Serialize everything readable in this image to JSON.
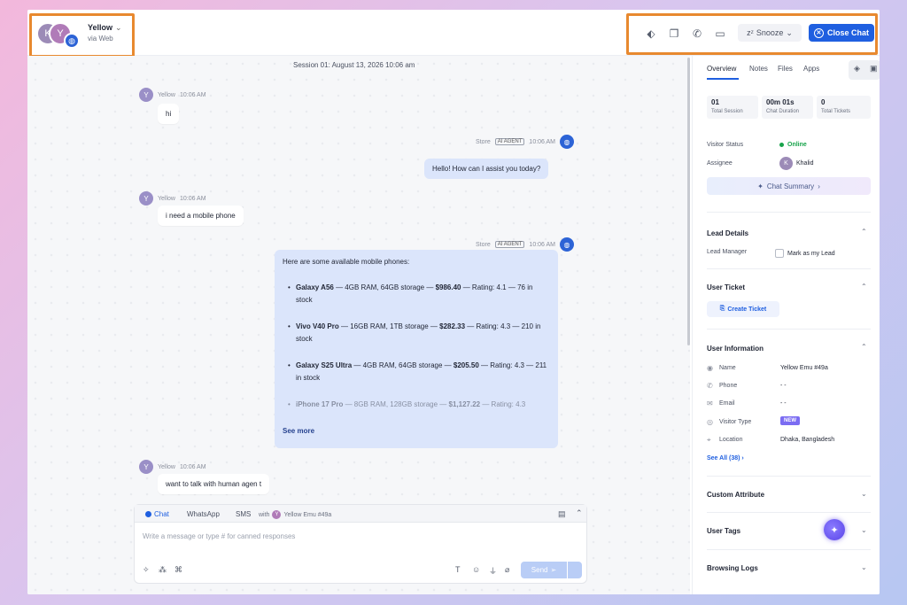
{
  "header": {
    "contact_name": "Yellow",
    "contact_sub": "via Web",
    "avatar_k": "K",
    "avatar_y": "Y",
    "snooze_label": "Snooze",
    "close_label": "Close Chat"
  },
  "chat": {
    "session_label": "Session 01: August 13, 2026 10:06 am",
    "messages": [
      {
        "sender": "Yellow",
        "time": "10:06 AM",
        "text": "hi"
      },
      {
        "sender": "Store",
        "badge": "AI AGENT",
        "time": "10:06 AM",
        "text": "Hello! How can I assist you today?"
      },
      {
        "sender": "Yellow",
        "time": "10:06 AM",
        "text": "i need a mobile phone"
      },
      {
        "sender": "Store",
        "badge": "AI AGENT",
        "time": "10:06 AM"
      },
      {
        "sender": "Yellow",
        "time": "10:06 AM",
        "text": "want to talk with human agen t"
      }
    ],
    "product_intro": "Here are some available mobile phones:",
    "products": [
      {
        "name": "Galaxy A56",
        "spec": " — 4GB RAM, 64GB storage — ",
        "price": "$986.40",
        "rest": " — Rating: 4.1 — 76 in stock"
      },
      {
        "name": "Vivo V40 Pro",
        "spec": " — 16GB RAM, 1TB storage — ",
        "price": "$282.33",
        "rest": " — Rating: 4.3 — 210 in stock"
      },
      {
        "name": "Galaxy S25 Ultra",
        "spec": " — 4GB RAM, 64GB storage — ",
        "price": "$205.50",
        "rest": " — Rating: 4.3 — 211 in stock"
      },
      {
        "name": "iPhone 17 Pro",
        "spec": " — 8GB RAM, 128GB storage — ",
        "price": "$1,127.22",
        "rest": " — Rating: 4.3"
      }
    ],
    "see_more": "See more"
  },
  "composer": {
    "tabs": [
      "Chat",
      "WhatsApp",
      "SMS"
    ],
    "with_label": "with",
    "with_user": "Yellow Emu #49a",
    "placeholder": "Write a message or type # for canned responses",
    "send_label": "Send"
  },
  "sidebar": {
    "tabs": [
      "Overview",
      "Notes",
      "Files",
      "Apps"
    ],
    "stats": [
      {
        "value": "01",
        "label": "Total Session"
      },
      {
        "value": "00m 01s",
        "label": "Chat Duration"
      },
      {
        "value": "0",
        "label": "Total Tickets"
      }
    ],
    "visitor_status_label": "Visitor Status",
    "visitor_status_value": "Online",
    "assignee_label": "Assignee",
    "assignee_value": "Khalid",
    "assignee_initial": "K",
    "chat_summary": "Chat Summary",
    "lead_details": "Lead Details",
    "lead_manager_label": "Lead Manager",
    "mark_as_lead": "Mark as my Lead",
    "user_ticket": "User Ticket",
    "create_ticket": "Create Ticket",
    "user_information": "User Information",
    "info_rows": [
      {
        "label": "Name",
        "value": "Yellow Emu #49a"
      },
      {
        "label": "Phone",
        "value": "- -"
      },
      {
        "label": "Email",
        "value": "- -"
      },
      {
        "label": "Visitor Type",
        "value": "NEW"
      },
      {
        "label": "Location",
        "value": "Dhaka, Bangladesh"
      }
    ],
    "see_all": "See All (38)",
    "sections": [
      "Custom Attribute",
      "User Tags",
      "Browsing Logs"
    ]
  },
  "colors": {
    "accent": "#1f5fe0",
    "highlight": "#e8892f",
    "online": "#17a34a",
    "agent_bubble": "#dbe5fb"
  }
}
